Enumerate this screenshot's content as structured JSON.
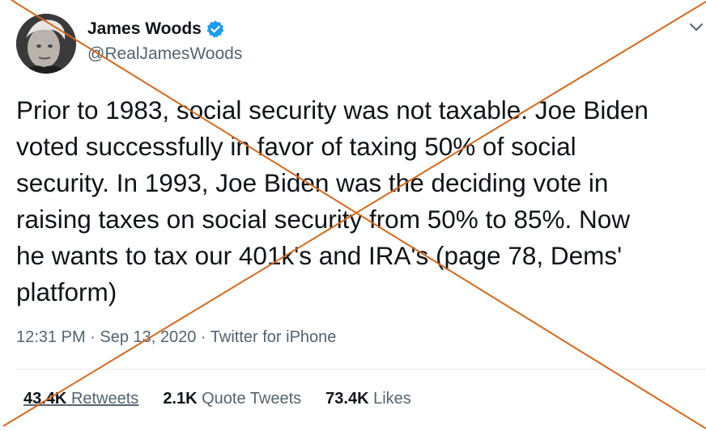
{
  "author": {
    "name": "James Woods",
    "handle": "@RealJamesWoods"
  },
  "tweet": {
    "text": "Prior to 1983, social security was not taxable. Joe Biden\nvoted successfully in favor of taxing 50% of social\nsecurity. In 1993, Joe Biden was the deciding vote in\nraising taxes on social security from 50% to 85%. Now\nhe wants to tax our 401k's and IRA's (page 78, Dems'\nplatform)",
    "timestamp": "12:31 PM · Sep 13, 2020 · Twitter for iPhone"
  },
  "stats": {
    "retweets_count": "43.4K",
    "retweets_label": "Retweets",
    "quotes_count": "2.1K",
    "quotes_label": "Quote Tweets",
    "likes_count": "73.4K",
    "likes_label": "Likes"
  },
  "colors": {
    "verified": "#1d9bf0",
    "cross_lines": "#d2691e",
    "secondary_text": "#536471"
  },
  "icons": {
    "verified": "verified-badge-icon",
    "more": "chevron-down-icon"
  }
}
